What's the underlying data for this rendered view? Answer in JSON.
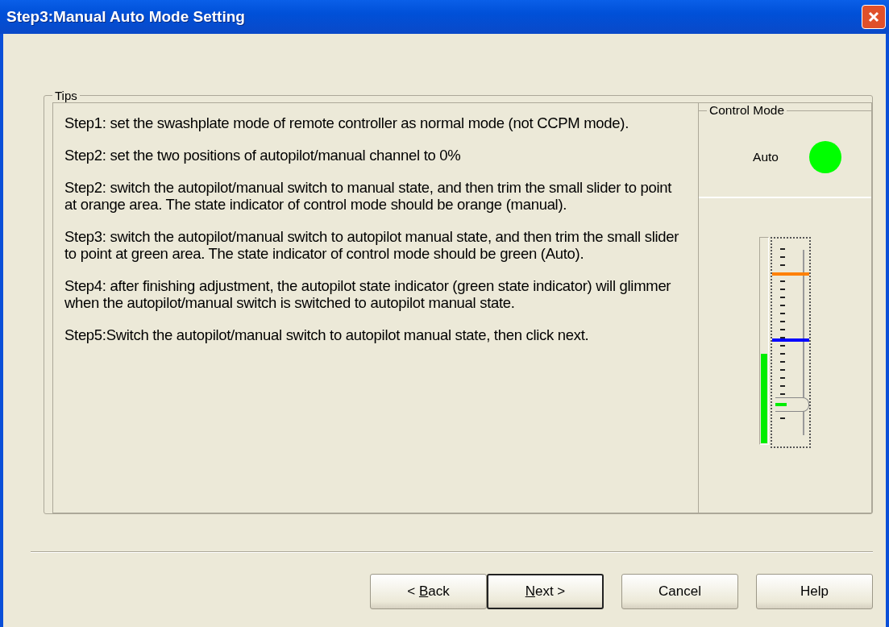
{
  "window": {
    "title": "Step3:Manual Auto Mode Setting"
  },
  "tips": {
    "legend": "Tips",
    "steps": [
      "Step1: set the swashplate mode of remote controller as normal mode (not CCPM mode).",
      "Step2: set the two positions of autopilot/manual channel to 0%",
      "Step2: switch the autopilot/manual switch to manual state, and then trim the small slider to point at orange area. The state indicator of control mode should be orange (manual).",
      "Step3: switch the autopilot/manual switch to autopilot manual state, and then trim the small slider to point at green area. The state indicator of control mode should be green (Auto).",
      "Step4: after finishing adjustment, the autopilot state indicator (green state indicator) will glimmer when the autopilot/manual switch is switched to autopilot manual state.",
      "Step5:Switch the autopilot/manual switch to autopilot manual state, then click next."
    ]
  },
  "control_mode": {
    "legend": "Control Mode",
    "state": "Auto",
    "color": "#00ff00"
  },
  "channel": {
    "meter": {
      "level": 0.44
    },
    "slider": {
      "level": 0.2
    }
  },
  "buttons": [
    {
      "before": "< ",
      "key": "B",
      "after": "ack",
      "default": false
    },
    {
      "key": "N",
      "after": "ext >",
      "default": true
    },
    {
      "after": "Cancel",
      "default": false
    },
    {
      "after": "Help",
      "default": false
    }
  ]
}
